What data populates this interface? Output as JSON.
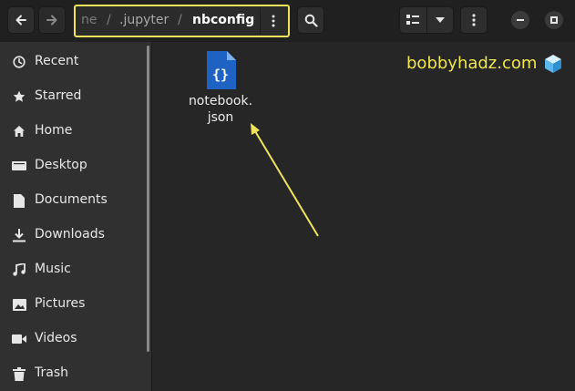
{
  "toolbar": {
    "back_icon": "arrow-left-icon",
    "forward_icon": "arrow-right-icon",
    "search_icon": "search-icon",
    "view_icon": "list-view-icon",
    "view_dropdown_icon": "chevron-down-icon",
    "menu_icon": "kebab-menu-icon",
    "minimize_icon": "minimize-icon",
    "maximize_icon": "maximize-icon"
  },
  "breadcrumb": {
    "items": [
      "ne",
      ".jupyter",
      "nbconfig"
    ],
    "separator": "/",
    "menu_icon": "kebab-menu-icon",
    "highlight_color": "#efe35c"
  },
  "sidebar": {
    "items": [
      {
        "label": "Recent",
        "icon": "clock-icon"
      },
      {
        "label": "Starred",
        "icon": "star-icon"
      },
      {
        "label": "Home",
        "icon": "home-icon"
      },
      {
        "label": "Desktop",
        "icon": "desktop-icon"
      },
      {
        "label": "Documents",
        "icon": "document-icon"
      },
      {
        "label": "Downloads",
        "icon": "download-icon"
      },
      {
        "label": "Music",
        "icon": "music-icon"
      },
      {
        "label": "Pictures",
        "icon": "picture-icon"
      },
      {
        "label": "Videos",
        "icon": "video-icon"
      },
      {
        "label": "Trash",
        "icon": "trash-icon"
      }
    ]
  },
  "files": [
    {
      "name_line1": "notebook.",
      "name_line2": "json",
      "icon": "json-file-icon"
    }
  ],
  "watermark": {
    "text": "bobbyhadz.com",
    "icon": "cube-icon",
    "color": "#f1e64d"
  },
  "annotation": {
    "arrow_color": "#efe35c"
  }
}
